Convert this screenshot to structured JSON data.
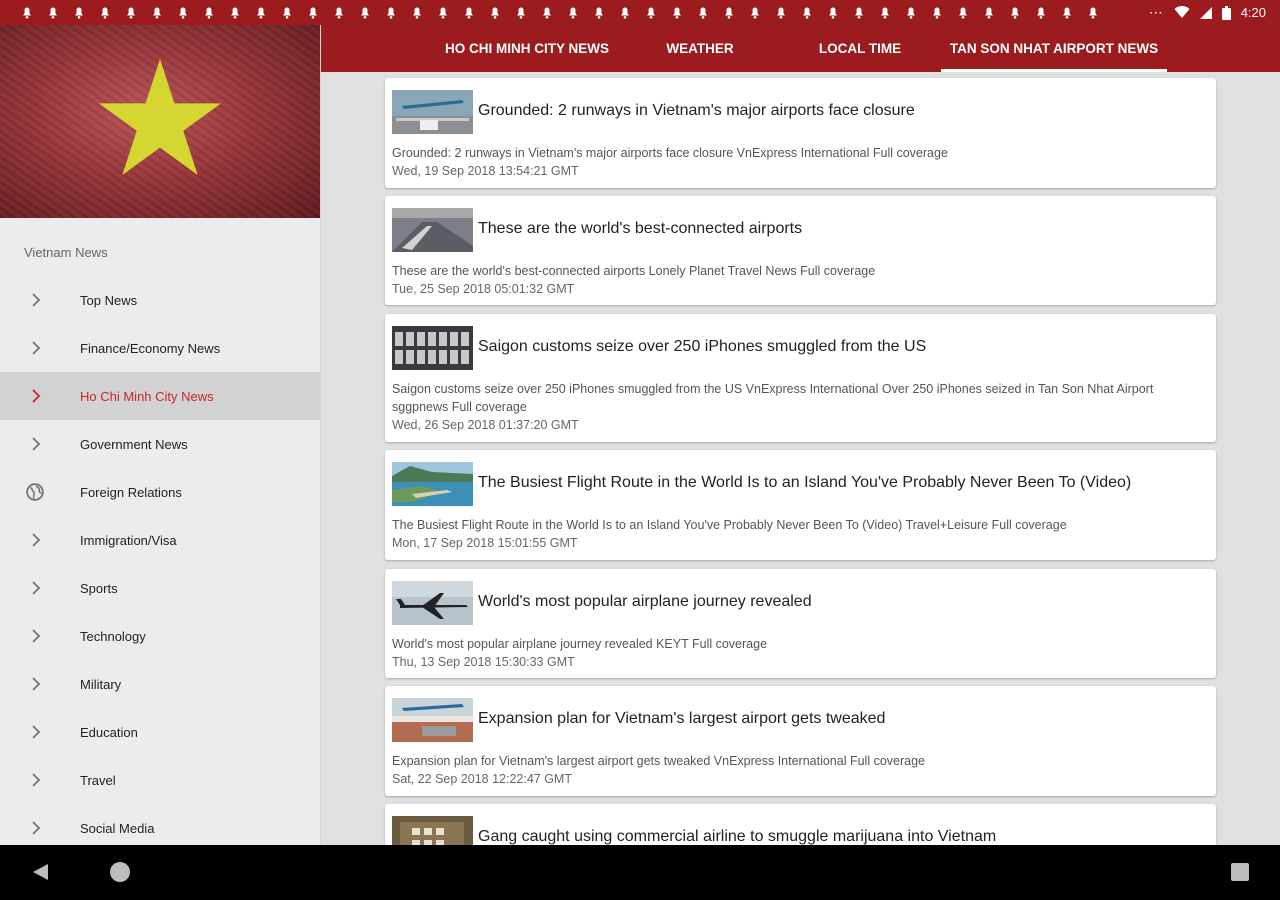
{
  "status_bar": {
    "notification_count": 42,
    "overflow": "⋯",
    "time": "4:20"
  },
  "sidebar": {
    "section_title": "Vietnam News",
    "items": [
      {
        "label": "Top News",
        "icon": "chevron-right-icon",
        "active": false
      },
      {
        "label": "Finance/Economy News",
        "icon": "chevron-right-icon",
        "active": false
      },
      {
        "label": "Ho Chi Minh City News",
        "icon": "chevron-right-icon",
        "active": true
      },
      {
        "label": "Government News",
        "icon": "chevron-right-icon",
        "active": false
      },
      {
        "label": "Foreign Relations",
        "icon": "globe-icon",
        "active": false
      },
      {
        "label": "Immigration/Visa",
        "icon": "chevron-right-icon",
        "active": false
      },
      {
        "label": "Sports",
        "icon": "chevron-right-icon",
        "active": false
      },
      {
        "label": "Technology",
        "icon": "chevron-right-icon",
        "active": false
      },
      {
        "label": "Military",
        "icon": "chevron-right-icon",
        "active": false
      },
      {
        "label": "Education",
        "icon": "chevron-right-icon",
        "active": false
      },
      {
        "label": "Travel",
        "icon": "chevron-right-icon",
        "active": false
      },
      {
        "label": "Social Media",
        "icon": "chevron-right-icon",
        "active": false
      }
    ]
  },
  "tabs": [
    {
      "label": "HO CHI MINH CITY NEWS",
      "selected": false
    },
    {
      "label": "WEATHER",
      "selected": false
    },
    {
      "label": "LOCAL TIME",
      "selected": false
    },
    {
      "label": "TAN SON NHAT AIRPORT NEWS",
      "selected": true
    }
  ],
  "articles": [
    {
      "title": "Grounded: 2 runways in Vietnam's major airports face closure",
      "description": "Grounded: 2 runways in Vietnam's major airports face closure  VnExpress International  Full coverage",
      "date": "Wed, 19 Sep 2018 13:54:21 GMT",
      "thumbnail": "airport-runway-thumbnail"
    },
    {
      "title": "These are the world's best-connected airports",
      "description": "These are the world's best-connected airports  Lonely Planet Travel News  Full coverage",
      "date": "Tue, 25 Sep 2018 05:01:32 GMT",
      "thumbnail": "city-airport-thumbnail"
    },
    {
      "title": "Saigon customs seize over 250 iPhones smuggled from the US",
      "description": "Saigon customs seize over 250 iPhones smuggled from the US  VnExpress International  Over 250 iPhones seized in Tan Son Nhat Airport  sggpnews  Full coverage",
      "date": "Wed, 26 Sep 2018 01:37:20 GMT",
      "thumbnail": "phones-thumbnail"
    },
    {
      "title": "The Busiest Flight Route in the World Is to an Island You've Probably Never Been To (Video)",
      "description": "The Busiest Flight Route in the World Is to an Island You've Probably Never Been To (Video)  Travel+Leisure  Full coverage",
      "date": "Mon, 17 Sep 2018 15:01:55 GMT",
      "thumbnail": "island-thumbnail"
    },
    {
      "title": "World's most popular airplane journey revealed",
      "description": "World's most popular airplane journey revealed  KEYT  Full coverage",
      "date": "Thu, 13 Sep 2018 15:30:33 GMT",
      "thumbnail": "airplane-thumbnail"
    },
    {
      "title": "Expansion plan for Vietnam's largest airport gets tweaked",
      "description": "Expansion plan for Vietnam's largest airport gets tweaked  VnExpress International  Full coverage",
      "date": "Sat, 22 Sep 2018 12:22:47 GMT",
      "thumbnail": "airport-plan-thumbnail"
    },
    {
      "title": "Gang caught using commercial airline to smuggle marijuana into Vietnam",
      "description": "",
      "date": "",
      "thumbnail": "packages-thumbnail"
    }
  ],
  "colors": {
    "primary": "#9b1b1e",
    "active_text": "#c62828",
    "flag_star": "#d6d633"
  }
}
